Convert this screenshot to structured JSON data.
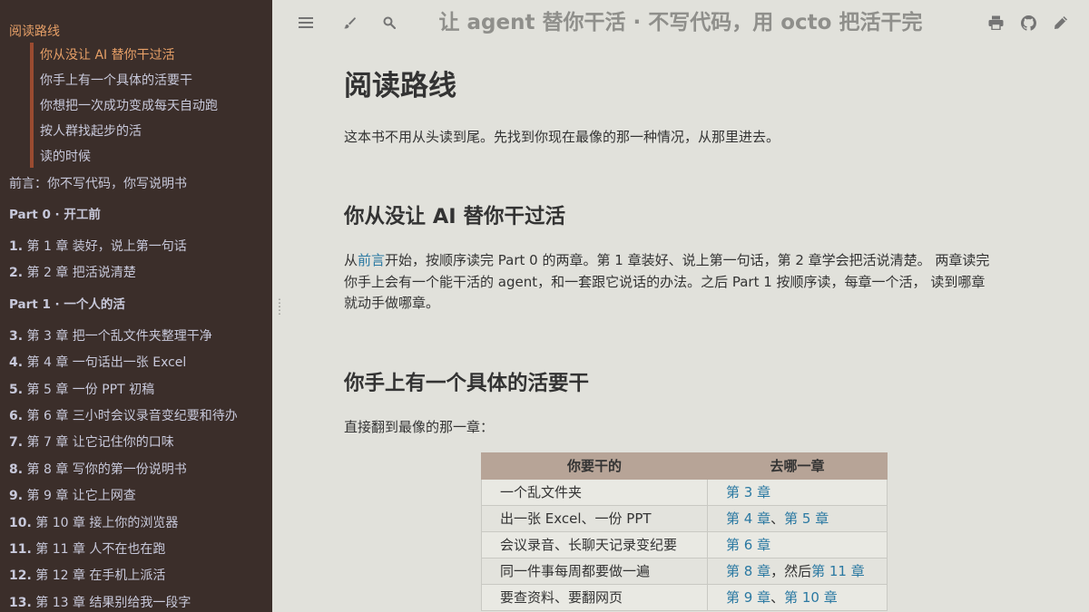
{
  "app": {
    "title": "让 agent 替你干活 · 不写代码，用 octo 把活干完"
  },
  "sidebar": {
    "current": "阅读路线",
    "subsections": [
      {
        "label": "你从没让 AI 替你干过活",
        "active": true
      },
      {
        "label": "你手上有一个具体的活要干",
        "active": false
      },
      {
        "label": "你想把一次成功变成每天自动跑",
        "active": false
      },
      {
        "label": "按人群找起步的活",
        "active": false
      },
      {
        "label": "读的时候",
        "active": false
      }
    ],
    "preface": "前言：你不写代码，你写说明书",
    "part0": "Part 0 · 开工前",
    "part0_chapters": [
      {
        "num": "1.",
        "label": "第 1 章 装好，说上第一句话"
      },
      {
        "num": "2.",
        "label": "第 2 章 把活说清楚"
      }
    ],
    "part1": "Part 1 · 一个人的活",
    "part1_chapters": [
      {
        "num": "3.",
        "label": "第 3 章 把一个乱文件夹整理干净"
      },
      {
        "num": "4.",
        "label": "第 4 章 一句话出一张 Excel"
      },
      {
        "num": "5.",
        "label": "第 5 章 一份 PPT 初稿"
      },
      {
        "num": "6.",
        "label": "第 6 章 三小时会议录音变纪要和待办"
      },
      {
        "num": "7.",
        "label": "第 7 章 让它记住你的口味"
      },
      {
        "num": "8.",
        "label": "第 8 章 写你的第一份说明书"
      },
      {
        "num": "9.",
        "label": "第 9 章 让它上网查"
      },
      {
        "num": "10.",
        "label": "第 10 章 接上你的浏览器"
      },
      {
        "num": "11.",
        "label": "第 11 章 人不在也在跑"
      },
      {
        "num": "12.",
        "label": "第 12 章 在手机上派活"
      },
      {
        "num": "13.",
        "label": "第 13 章 结果别给我一段字"
      }
    ]
  },
  "toolbar": {
    "icons": [
      "menu-icon",
      "paintbrush-icon",
      "search-icon",
      "print-icon",
      "github-icon",
      "edit-icon"
    ]
  },
  "content": {
    "h1": "阅读路线",
    "intro": "这本书不用从头读到尾。先找到你现在最像的那一种情况，从那里进去。",
    "s1_title": "你从没让 AI 替你干过活",
    "s1_pre": "从",
    "s1_link": "前言",
    "s1_line1": "开始，按顺序读完 Part 0 的两章。第 1 章装好、说上第一句话，第 2 章学会把活说清楚。 两章读完",
    "s1_line2": "你手上会有一个能干活的 agent，和一套跟它说话的办法。之后 Part 1 按顺序读，每章一个活， 读到哪章",
    "s1_line3": "就动手做哪章。",
    "s2_title": "你手上有一个具体的活要干",
    "s2_intro": "直接翻到最像的那一章："
  },
  "table": {
    "headers": [
      "你要干的",
      "去哪一章"
    ],
    "rows": [
      {
        "task": "一个乱文件夹",
        "links": [
          "第 3 章"
        ],
        "sep": "",
        "tail": ""
      },
      {
        "task": "出一张 Excel、一份 PPT",
        "links": [
          "第 4 章",
          "第 5 章"
        ],
        "sep": "、",
        "tail": ""
      },
      {
        "task": "会议录音、长聊天记录变纪要",
        "links": [
          "第 6 章"
        ],
        "sep": "",
        "tail": ""
      },
      {
        "task": "同一件事每周都要做一遍",
        "links": [
          "第 8 章",
          "第 11 章"
        ],
        "sep": "，然后",
        "tail": ""
      },
      {
        "task": "要查资料、要翻网页",
        "links": [
          "第 9 章",
          "第 10 章"
        ],
        "sep": "、",
        "tail": ""
      }
    ]
  },
  "colors": {
    "sidebar_bg": "#3b2e2a",
    "sidebar_text": "#c8c9db",
    "accent": "#e69f67",
    "link": "#2b79a2",
    "page_bg": "#e1e1db",
    "table_header": "#b7a497"
  }
}
